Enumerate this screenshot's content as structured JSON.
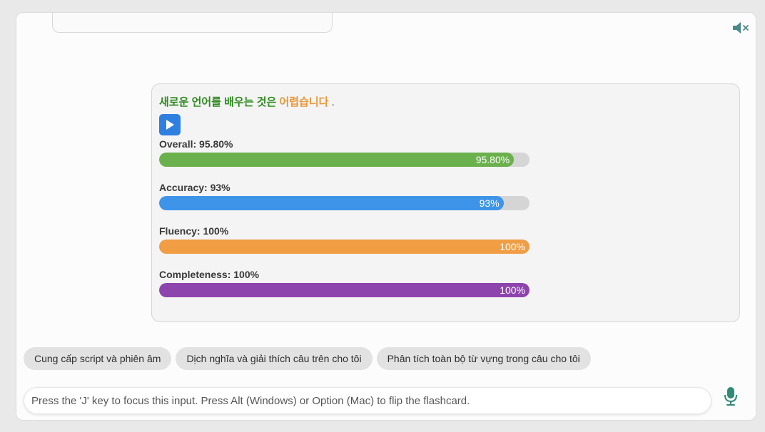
{
  "sentence": {
    "part1": "새로운 언어를 배우는 것은",
    "part2": "어렵습니다",
    "punct": ".",
    "correct_color": "#2e8b1f",
    "warning_color": "#e8973a"
  },
  "metrics": [
    {
      "label": "Overall: 95.80%",
      "value_text": "95.80%",
      "value": 95.8,
      "color": "#6ab04c"
    },
    {
      "label": "Accuracy: 93%",
      "value_text": "93%",
      "value": 93,
      "color": "#3d94e8"
    },
    {
      "label": "Fluency: 100%",
      "value_text": "100%",
      "value": 100,
      "color": "#f09d44"
    },
    {
      "label": "Completeness: 100%",
      "value_text": "100%",
      "value": 100,
      "color": "#8e44ad"
    }
  ],
  "suggestions": [
    "Cung cấp script và phiên âm",
    "Dịch nghĩa và giải thích câu trên cho tôi",
    "Phân tích toàn bộ từ vựng trong câu cho tôi"
  ],
  "input": {
    "placeholder": "Press the 'J' key to focus this input. Press Alt (Windows) or Option (Mac) to flip the flashcard."
  },
  "icons": {
    "mute": "speaker-muted-icon",
    "play": "play-icon",
    "mic": "microphone-icon"
  }
}
